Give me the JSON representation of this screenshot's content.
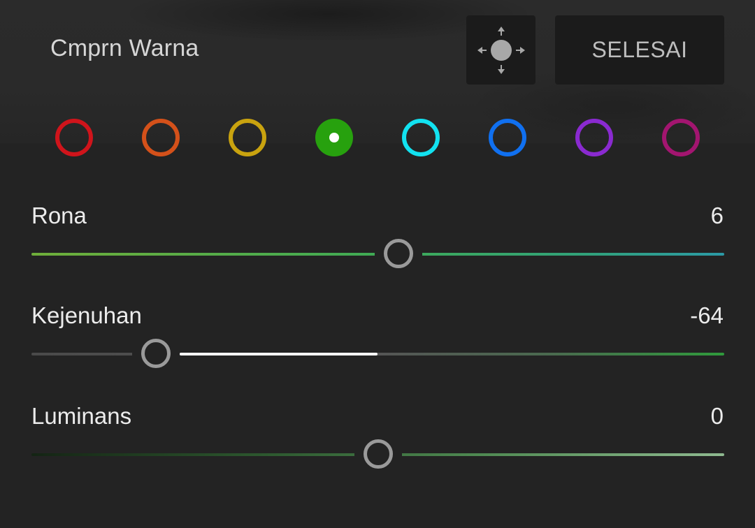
{
  "header": {
    "title": "Cmprn Warna",
    "move_icon": "move-arrows-icon",
    "done_label": "SELESAI"
  },
  "swatches": [
    {
      "name": "red",
      "color": "#d0141b",
      "selected": false
    },
    {
      "name": "orange",
      "color": "#d4511a",
      "selected": false
    },
    {
      "name": "yellow",
      "color": "#c9a30f",
      "selected": false
    },
    {
      "name": "green",
      "color": "#27a10e",
      "selected": true
    },
    {
      "name": "aqua",
      "color": "#12e2f0",
      "selected": false
    },
    {
      "name": "blue",
      "color": "#1070f0",
      "selected": false
    },
    {
      "name": "purple",
      "color": "#8a2ad0",
      "selected": false
    },
    {
      "name": "magenta",
      "color": "#a31570",
      "selected": false
    }
  ],
  "sliders": [
    {
      "id": "hue",
      "label": "Rona",
      "value": "6",
      "level": 0.53
    },
    {
      "id": "saturation",
      "label": "Kejenuhan",
      "value": "-64",
      "level": 0.18
    },
    {
      "id": "luminance",
      "label": "Luminans",
      "value": "0",
      "level": 0.5
    }
  ]
}
